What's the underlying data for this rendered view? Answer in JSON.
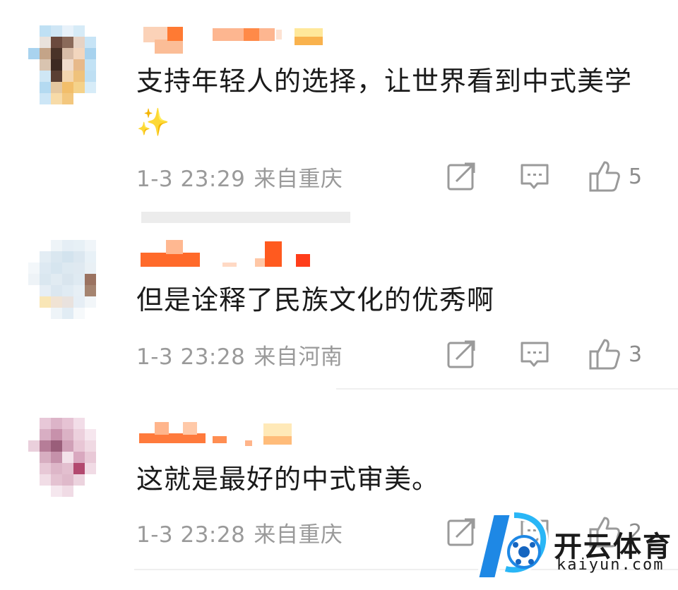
{
  "comments": [
    {
      "text": "支持年轻人的选择，让世界看到中式美学✨",
      "time": "1-3 23:29",
      "location": "来自重庆",
      "likes": "5"
    },
    {
      "text": "但是诠释了民族文化的优秀啊",
      "time": "1-3 23:28",
      "location": "来自河南",
      "likes": "3"
    },
    {
      "text": "这就是最好的中式审美。",
      "time": "1-3 23:28",
      "location": "来自重庆",
      "likes": "2"
    }
  ],
  "icons": {
    "share": "share-icon",
    "comment": "comment-icon",
    "like": "thumbs-up-icon"
  },
  "colors": {
    "username_accent": "#ff7a33",
    "meta_text": "#9a9a9a",
    "watermark_blue": "#1e88e5"
  },
  "watermark": {
    "cn": "开云体育",
    "en": "kaiyun.com"
  }
}
